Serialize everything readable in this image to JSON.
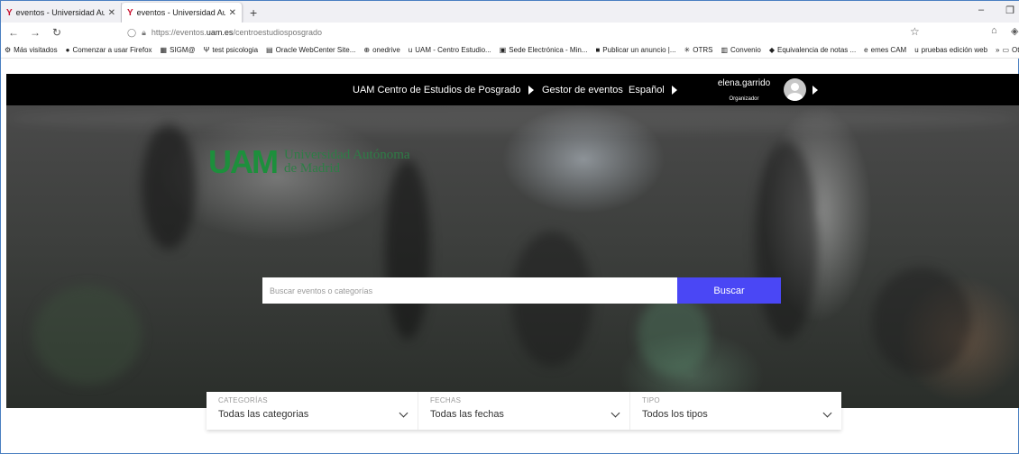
{
  "browser": {
    "tabs": [
      {
        "title": "eventos - Universidad Autónom",
        "active": false
      },
      {
        "title": "eventos - Universidad Autónom",
        "active": true
      }
    ],
    "url_prefix": "https://eventos.",
    "url_domain": "uam.es",
    "url_path": "/centroestudiosposgrado",
    "bookmarks": [
      {
        "icon": "gear-icon",
        "label": "Más visitados"
      },
      {
        "icon": "firefox-icon",
        "label": "Comenzar a usar Firefox"
      },
      {
        "icon": "sigm-icon",
        "label": "SIGM@"
      },
      {
        "icon": "psy-icon",
        "label": "test psicologia"
      },
      {
        "icon": "oracle-icon",
        "label": "Oracle WebCenter Site..."
      },
      {
        "icon": "globe-icon",
        "label": "onedrive"
      },
      {
        "icon": "uam-icon",
        "label": "UAM - Centro Estudio..."
      },
      {
        "icon": "sede-icon",
        "label": "Sede Electrónica - Min..."
      },
      {
        "icon": "publicar-icon",
        "label": "Publicar un anuncio |..."
      },
      {
        "icon": "otrs-icon",
        "label": "OTRS"
      },
      {
        "icon": "convenio-icon",
        "label": "Convenio"
      },
      {
        "icon": "notas-icon",
        "label": "Equivalencia de notas ..."
      },
      {
        "icon": "edge-icon",
        "label": "emes CAM"
      },
      {
        "icon": "uam-icon",
        "label": "pruebas edición web"
      }
    ],
    "other_bookmarks": "Otros ma"
  },
  "header": {
    "center_name": "UAM Centro de Estudios de Posgrado",
    "events_manager": "Gestor de eventos",
    "language": "Español",
    "username": "elena.garrido",
    "role": "Organizador"
  },
  "hero": {
    "logo_mark": "UAM",
    "logo_line1": "Universidad Autónoma",
    "logo_line2": "de Madrid",
    "search_placeholder": "Buscar eventos o categorías",
    "search_button": "Buscar"
  },
  "filters": [
    {
      "label": "CATEGORÍAS",
      "value": "Todas las categorias"
    },
    {
      "label": "FECHAS",
      "value": "Todas las fechas"
    },
    {
      "label": "TIPO",
      "value": "Todos los tipos"
    }
  ],
  "colors": {
    "search_button": "#4a47f5",
    "logo_green": "#1d8f3c",
    "topbar": "#000000"
  }
}
